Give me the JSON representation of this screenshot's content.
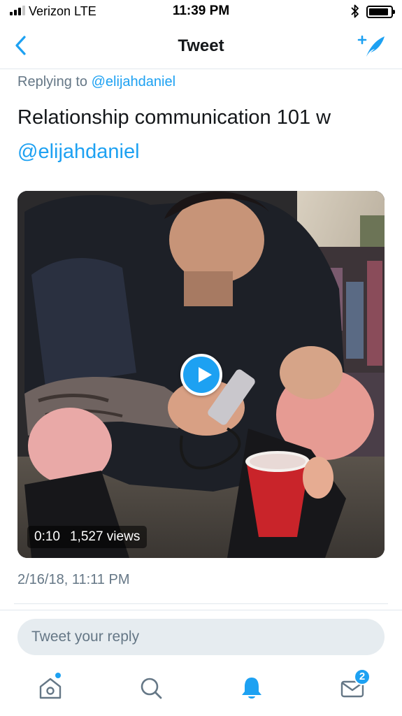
{
  "status_bar": {
    "carrier": "Verizon  LTE",
    "time": "11:39 PM"
  },
  "nav": {
    "title": "Tweet"
  },
  "tweet": {
    "replying_prefix": "Replying to ",
    "replying_handle": "@elijahdaniel",
    "text": "Relationship communication 101 w ",
    "mention": "@elijahdaniel",
    "timestamp": "2/16/18, 11:11 PM"
  },
  "video": {
    "duration": "0:10",
    "views": "1,527 views"
  },
  "reply": {
    "placeholder": "Tweet your reply"
  },
  "tab_bar": {
    "messages_badge": "2"
  },
  "colors": {
    "accent": "#1da1f2",
    "secondary_text": "#657786",
    "primary_text": "#14171a",
    "reply_bg": "#e6ecf0"
  },
  "icons": {
    "back": "chevron-left-icon",
    "compose": "compose-tweet-icon",
    "home": "home-icon",
    "search": "search-icon",
    "notifications": "bell-icon",
    "messages": "envelope-icon",
    "play": "play-icon",
    "bluetooth": "bluetooth-icon",
    "battery": "battery-icon",
    "signal": "signal-icon"
  }
}
